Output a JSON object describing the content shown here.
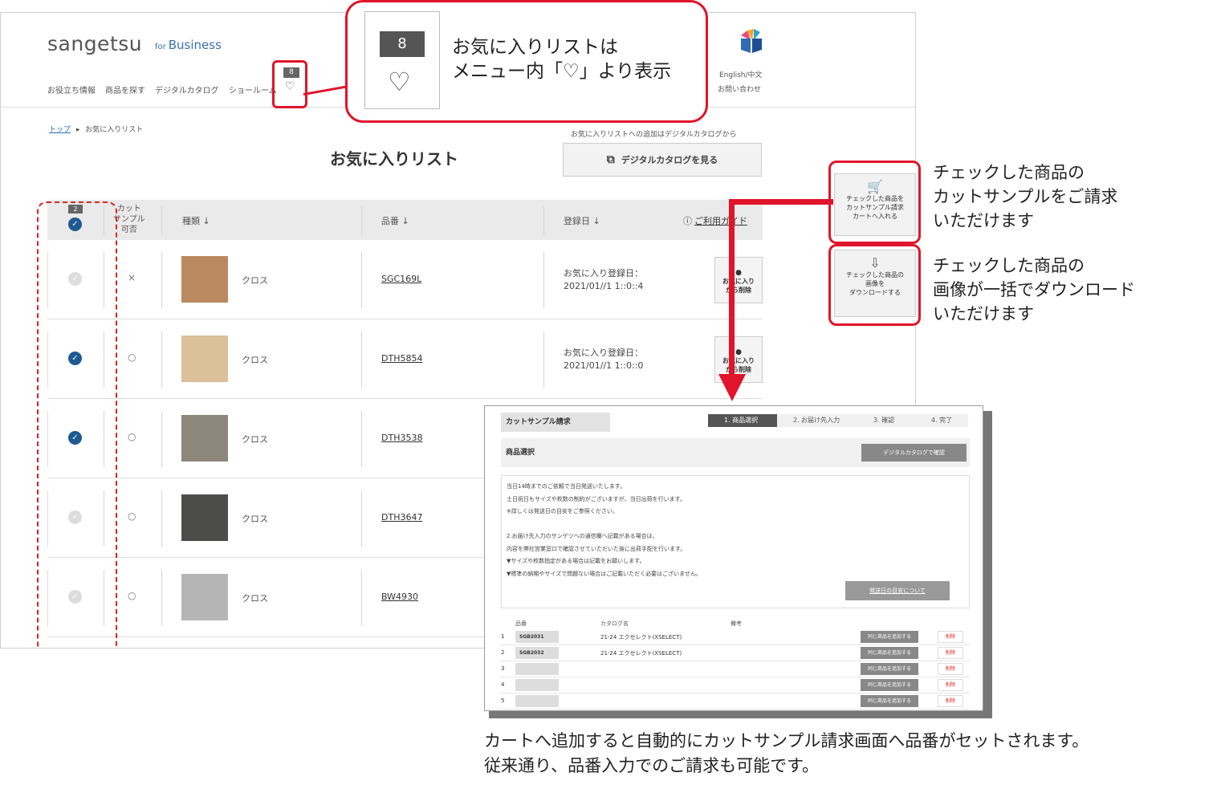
{
  "site": {
    "logo": "sangetsu",
    "logo_for": "for",
    "logo_business": "Business",
    "nav": [
      "お役立ち情報",
      "商品を探す",
      "デジタルカタログ",
      "ショールーム"
    ],
    "favorites_badge": "8",
    "heart_icon": "♡",
    "lang": "English/中文",
    "contact": "お問い合わせ",
    "breadcrumb_top": "トップ",
    "breadcrumb_sep": "▸",
    "breadcrumb_current": "お気に入りリスト",
    "page_title": "お気に入りリスト",
    "catalog_note": "お気に入りリストへの追加はデジタルカタログから",
    "catalog_button": "デジタルカタログを見る",
    "table_header": {
      "checked_count": "2",
      "cut_sample": "カット\nサンプル\n可否",
      "kind": "種類 ↓",
      "code": "品番 ↓",
      "date": "登録日 ↓",
      "guide": "ご利用ガイド",
      "guide_icon": "ⓘ"
    },
    "rows": [
      {
        "checked": false,
        "cut": "×",
        "kind": "クロス",
        "code": "SGC169L",
        "date_label": "お気に入り登録日：",
        "date": "2021/01//1 1::0::4",
        "delete": "お気に入り\nから削除",
        "swatch": "#b98a5f"
      },
      {
        "checked": true,
        "cut": "○",
        "kind": "クロス",
        "code": "DTH5854",
        "date_label": "お気に入り登録日：",
        "date": "2021/01//1 1::0::0",
        "delete": "お気に入り\nから削除",
        "swatch": "#dcc09a"
      },
      {
        "checked": true,
        "cut": "○",
        "kind": "クロス",
        "code": "DTH3538",
        "date_label": "",
        "date": "",
        "delete": "",
        "swatch": "#8c877a"
      },
      {
        "checked": false,
        "cut": "○",
        "kind": "クロス",
        "code": "DTH3647",
        "date_label": "",
        "date": "",
        "delete": "",
        "swatch": "#4c4d4a"
      },
      {
        "checked": false,
        "cut": "○",
        "kind": "クロス",
        "code": "BW4930",
        "date_label": "",
        "date": "",
        "delete": "",
        "swatch": "#b5b5b5"
      }
    ]
  },
  "callout": {
    "badge": "8",
    "heart": "♡",
    "text": "お気に入りリストは\nメニュー内「♡」より表示"
  },
  "side": {
    "cart_button": "チェックした商品を\nカットサンプル請求\nカートへ入れる",
    "cart_text": "チェックした商品の\nカットサンプルをご請求\nいただけます",
    "download_button": "チェックした商品の\n画像を\nダウンロードする",
    "download_text": "チェックした商品の\n画像が一括でダウンロード\nいただけます"
  },
  "form": {
    "title": "カットサンプル請求",
    "steps": [
      "1. 商品選択",
      "2. お届け先入力",
      "3. 確認",
      "4. 完了"
    ],
    "section": "商品選択",
    "catalog_confirm": "デジタルカタログで確認",
    "notice_lines": [
      "当日14時までのご依頼で当日発送いたします。",
      "土日祝日もサイズや枚数の制約がございますが、当日出荷を行います。",
      "※詳しくは発送日の目安をご参照ください。",
      "",
      "2.お届け先入力のサンゲツへの通信欄へ記載がある場合は、",
      "内容を弊社営業窓口で確認させていただいた後に出荷手配を行います。",
      "▼サイズや枚数指定がある場合は記載をお願いします。",
      "▼標準の納期やサイズで問題ない場合はご記載いただく必要はございません。"
    ],
    "notice_button": "発送日の目安について",
    "col_code": "品番",
    "col_catalog": "カタログ名",
    "col_note": "備考",
    "rows": [
      {
        "num": "1",
        "code": "SGB2031",
        "catalog": "21-24 エクセレクト(XSELECT)"
      },
      {
        "num": "2",
        "code": "SGB2032",
        "catalog": "21-24 エクセレクト(XSELECT)"
      },
      {
        "num": "3",
        "code": "",
        "catalog": ""
      },
      {
        "num": "4",
        "code": "",
        "catalog": ""
      },
      {
        "num": "5",
        "code": "",
        "catalog": ""
      }
    ],
    "add_label": "同じ商品を追加する",
    "delete_label": "削除"
  },
  "bottom_text": "カートへ追加すると自動的にカットサンプル請求画面へ品番がセットされます。\n従来通り、品番入力でのご請求も可能です。",
  "colors": {
    "accent_red": "#e0142a",
    "check_blue": "#1e5a93",
    "brand_blue": "#3a6fb3"
  }
}
